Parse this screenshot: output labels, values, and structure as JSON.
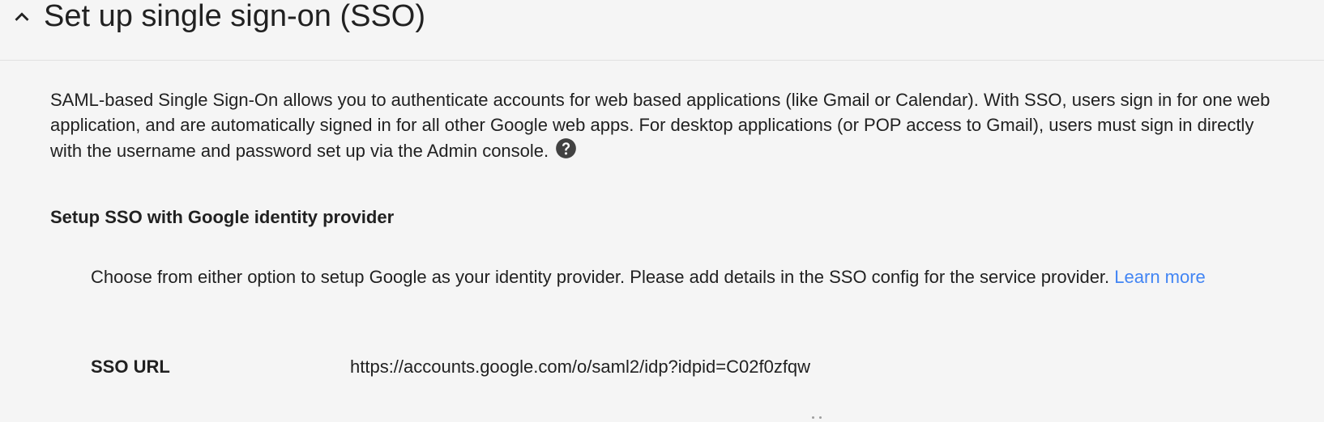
{
  "section": {
    "title": "Set up single sign-on (SSO)",
    "collapse_icon": "chevron-up-icon"
  },
  "description": {
    "text": "SAML-based Single Sign-On allows you to authenticate accounts for web based applications (like Gmail or Calendar). With SSO, users sign in for one web application, and are automatically signed in for all other Google web apps. For desktop applications (or POP access to Gmail), users must sign in directly with the username and password set up via the Admin console.",
    "help_icon": "help-circle-icon"
  },
  "idp": {
    "heading": "Setup SSO with Google identity provider",
    "intro": "Choose from either option to setup Google as your identity provider. Please add details in the SSO config for the service provider.",
    "learn_more": "Learn more",
    "fields": [
      {
        "label": "SSO URL",
        "value": "https://accounts.google.com/o/saml2/idp?idpid=C02f0zfqw"
      }
    ]
  },
  "colors": {
    "background": "#f5f5f5",
    "text": "#212121",
    "link": "#4285f4",
    "divider": "#e0e0e0"
  }
}
